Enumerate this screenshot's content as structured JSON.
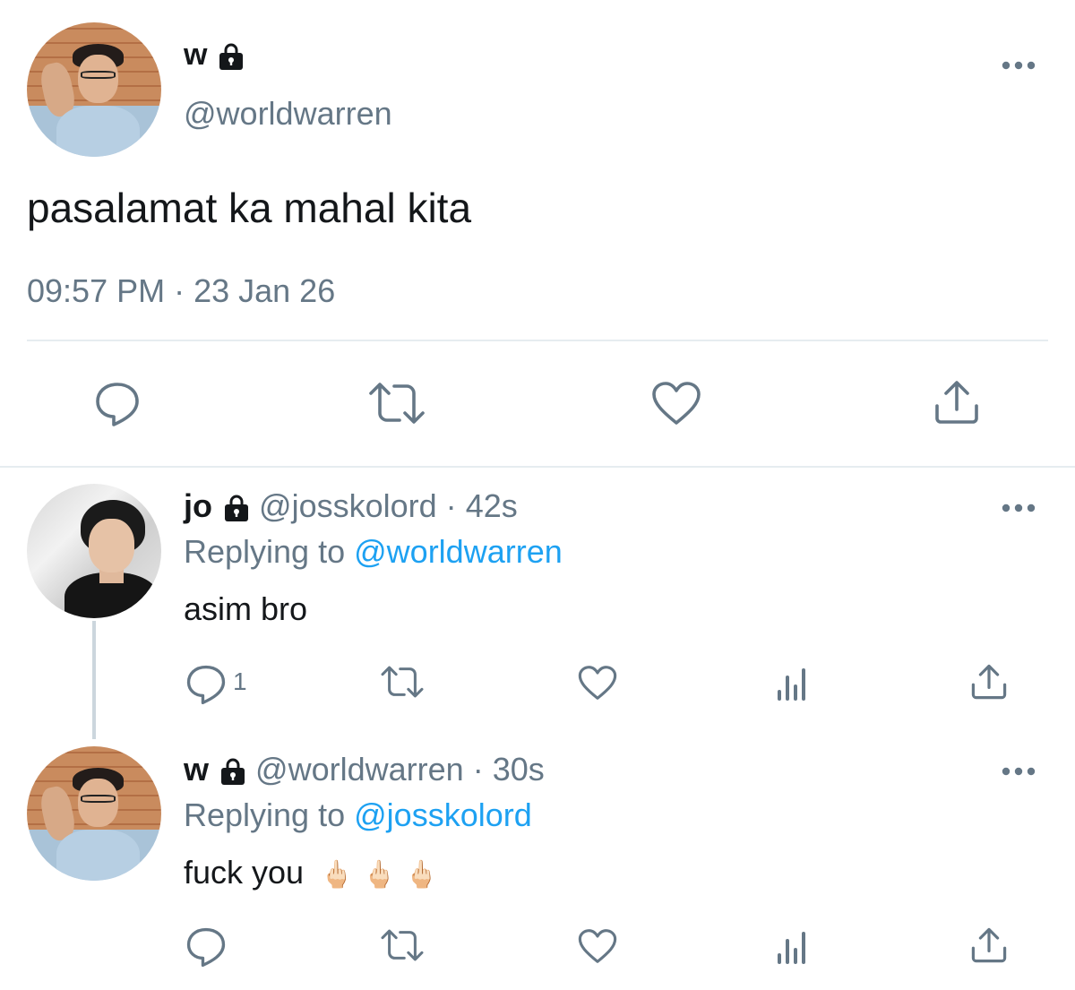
{
  "main_tweet": {
    "display_name": "w",
    "handle": "@worldwarren",
    "text": "pasalamat ka mahal kita",
    "timestamp": "09:57 PM · 23 Jan 26"
  },
  "replies": [
    {
      "display_name": "jo",
      "handle": "@josskolord",
      "separator": "·",
      "age": "42s",
      "replying_label": "Replying to",
      "replying_handle": "@worldwarren",
      "text": "asim bro",
      "reply_count": "1"
    },
    {
      "display_name": "w",
      "handle": "@worldwarren",
      "separator": "·",
      "age": "30s",
      "replying_label": "Replying to",
      "replying_handle": "@josskolord",
      "text": "fuck you",
      "emoji": "🖕🏻🖕🏻🖕🏻",
      "reply_count": ""
    }
  ],
  "icons": {
    "more": "more-dots-icon",
    "reply": "reply-icon",
    "retweet": "retweet-icon",
    "like": "heart-icon",
    "share": "share-icon",
    "analytics": "analytics-icon",
    "lock": "lock-icon"
  },
  "colors": {
    "text": "#14171a",
    "secondary": "#657786",
    "accent": "#1da1f2",
    "divider": "#e6ecf0"
  }
}
